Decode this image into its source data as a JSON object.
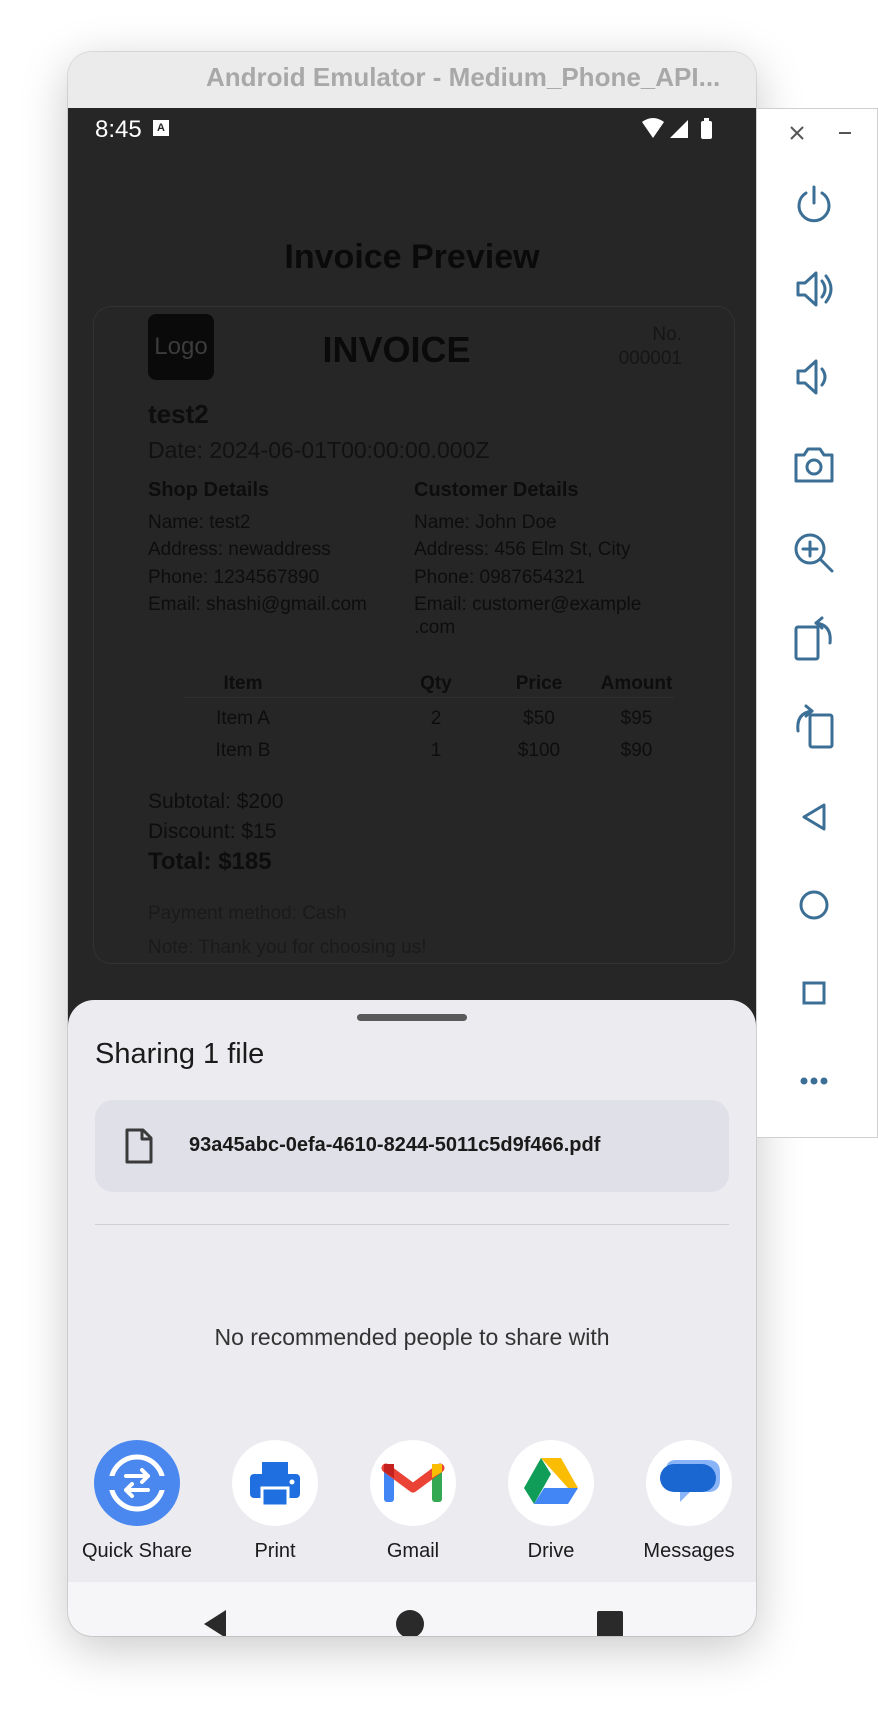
{
  "window": {
    "title": "Android Emulator - Medium_Phone_API..."
  },
  "status_bar": {
    "time": "8:45",
    "badge": "A"
  },
  "screen": {
    "title": "Invoice Preview"
  },
  "invoice": {
    "logo": "Logo",
    "title": "INVOICE",
    "number_label": "No.",
    "number": "000001",
    "shop_name": "test2",
    "date": "Date: 2024-06-01T00:00:00.000Z",
    "shop_details": {
      "heading": "Shop Details",
      "name": "Name: test2",
      "address": "Address: newaddress",
      "phone": "Phone: 1234567890",
      "email": "Email: shashi@gmail.com"
    },
    "customer_details": {
      "heading": "Customer Details",
      "name": "Name: John Doe",
      "address": "Address: 456 Elm St, City",
      "phone": "Phone: 0987654321",
      "email_line1": "Email: customer@example",
      "email_line2": ".com"
    },
    "table": {
      "headers": [
        "Item",
        "Qty",
        "Price",
        "Amount"
      ],
      "rows": [
        [
          "Item A",
          "2",
          "$50",
          "$95"
        ],
        [
          "Item B",
          "1",
          "$100",
          "$90"
        ]
      ]
    },
    "subtotal": "Subtotal: $200",
    "discount": "Discount: $15",
    "total": "Total: $185",
    "payment": "Payment method: Cash",
    "note": "Note: Thank you for choosing us!"
  },
  "share_sheet": {
    "title": "Sharing 1 file",
    "file_name": "93a45abc-0efa-4610-8244-5011c5d9f466.pdf",
    "no_recommendations": "No recommended people to share with",
    "apps": [
      {
        "label": "Quick Share",
        "icon": "quick-share-icon"
      },
      {
        "label": "Print",
        "icon": "print-icon"
      },
      {
        "label": "Gmail",
        "icon": "gmail-icon"
      },
      {
        "label": "Drive",
        "icon": "drive-icon"
      },
      {
        "label": "Messages",
        "icon": "messages-icon"
      }
    ]
  },
  "emulator_controls": [
    "power-icon",
    "volume-up-icon",
    "volume-down-icon",
    "camera-icon",
    "zoom-icon",
    "rotate-left-icon",
    "rotate-right-icon",
    "back-icon",
    "home-icon",
    "overview-icon",
    "more-icon"
  ],
  "colors": {
    "accent": "#4285f4",
    "scrim_bg": "#262626",
    "sheet_bg": "#ebebf0"
  }
}
